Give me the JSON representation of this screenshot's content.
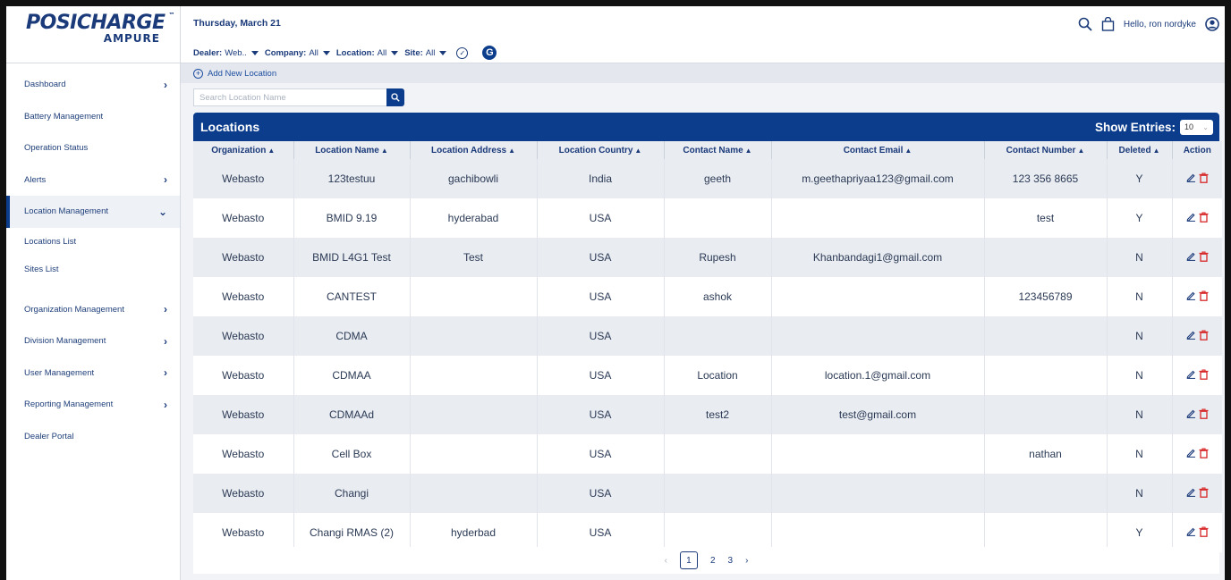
{
  "brand": {
    "name": "POSICHARGE",
    "tm": "™",
    "sub": "AMPURE"
  },
  "sidebar": {
    "items": [
      {
        "label": "Dashboard",
        "chevron": "›"
      },
      {
        "label": "Battery Management"
      },
      {
        "label": "Operation Status"
      },
      {
        "label": "Alerts",
        "chevron": "›"
      },
      {
        "label": "Location Management",
        "chevron": "⌄"
      },
      {
        "label": "Locations List"
      },
      {
        "label": "Sites List"
      },
      {
        "label": "Organization Management",
        "chevron": "›"
      },
      {
        "label": "Division Management",
        "chevron": "›"
      },
      {
        "label": "User Management",
        "chevron": "›"
      },
      {
        "label": "Reporting Management",
        "chevron": "›"
      },
      {
        "label": "Dealer Portal"
      }
    ]
  },
  "header": {
    "date": "Thursday, March 21",
    "greeting": "Hello, ron nordyke",
    "filters": [
      {
        "label": "Dealer:",
        "value": "Web.."
      },
      {
        "label": "Company:",
        "value": "All"
      },
      {
        "label": "Location:",
        "value": "All"
      },
      {
        "label": "Site:",
        "value": "All"
      }
    ],
    "g_label": "G"
  },
  "toolbar": {
    "add_label": "Add New Location"
  },
  "search": {
    "placeholder": "Search Location Name"
  },
  "panel": {
    "title": "Locations",
    "show_entries_label": "Show Entries:",
    "entries_value": "10"
  },
  "table": {
    "columns": [
      "Organization",
      "Location Name",
      "Location Address",
      "Location Country",
      "Contact Name",
      "Contact Email",
      "Contact Number",
      "Deleted",
      "Action"
    ],
    "rows": [
      [
        "Webasto",
        "123testuu",
        "gachibowli",
        "India",
        "geeth",
        "m.geethapriyaa123@gmail.com",
        "123 356 8665",
        "Y"
      ],
      [
        "Webasto",
        "BMID 9.19",
        "hyderabad",
        "USA",
        "",
        "",
        "test",
        "Y"
      ],
      [
        "Webasto",
        "BMID L4G1 Test",
        "Test",
        "USA",
        "Rupesh",
        "Khanbandagi1@gmail.com",
        "",
        "N"
      ],
      [
        "Webasto",
        "CANTEST",
        "",
        "USA",
        "ashok",
        "",
        "123456789",
        "N"
      ],
      [
        "Webasto",
        "CDMA",
        "",
        "USA",
        "",
        "",
        "",
        "N"
      ],
      [
        "Webasto",
        "CDMAA",
        "",
        "USA",
        "Location",
        "location.1@gmail.com",
        "",
        "N"
      ],
      [
        "Webasto",
        "CDMAAd",
        "",
        "USA",
        "test2",
        "test@gmail.com",
        "",
        "N"
      ],
      [
        "Webasto",
        "Cell Box",
        "",
        "USA",
        "",
        "",
        "nathan",
        "N"
      ],
      [
        "Webasto",
        "Changi",
        "",
        "USA",
        "",
        "",
        "",
        "N"
      ],
      [
        "Webasto",
        "Changi RMAS (2)",
        "hyderbad",
        "USA",
        "",
        "",
        "",
        "Y"
      ]
    ]
  },
  "pagination": {
    "prev": "‹",
    "pages": [
      "1",
      "2",
      "3"
    ],
    "current": "1",
    "next": "›"
  },
  "colors": {
    "primary": "#0b3d8c",
    "row_alt": "#e9ecf1",
    "delete": "#d62828"
  }
}
